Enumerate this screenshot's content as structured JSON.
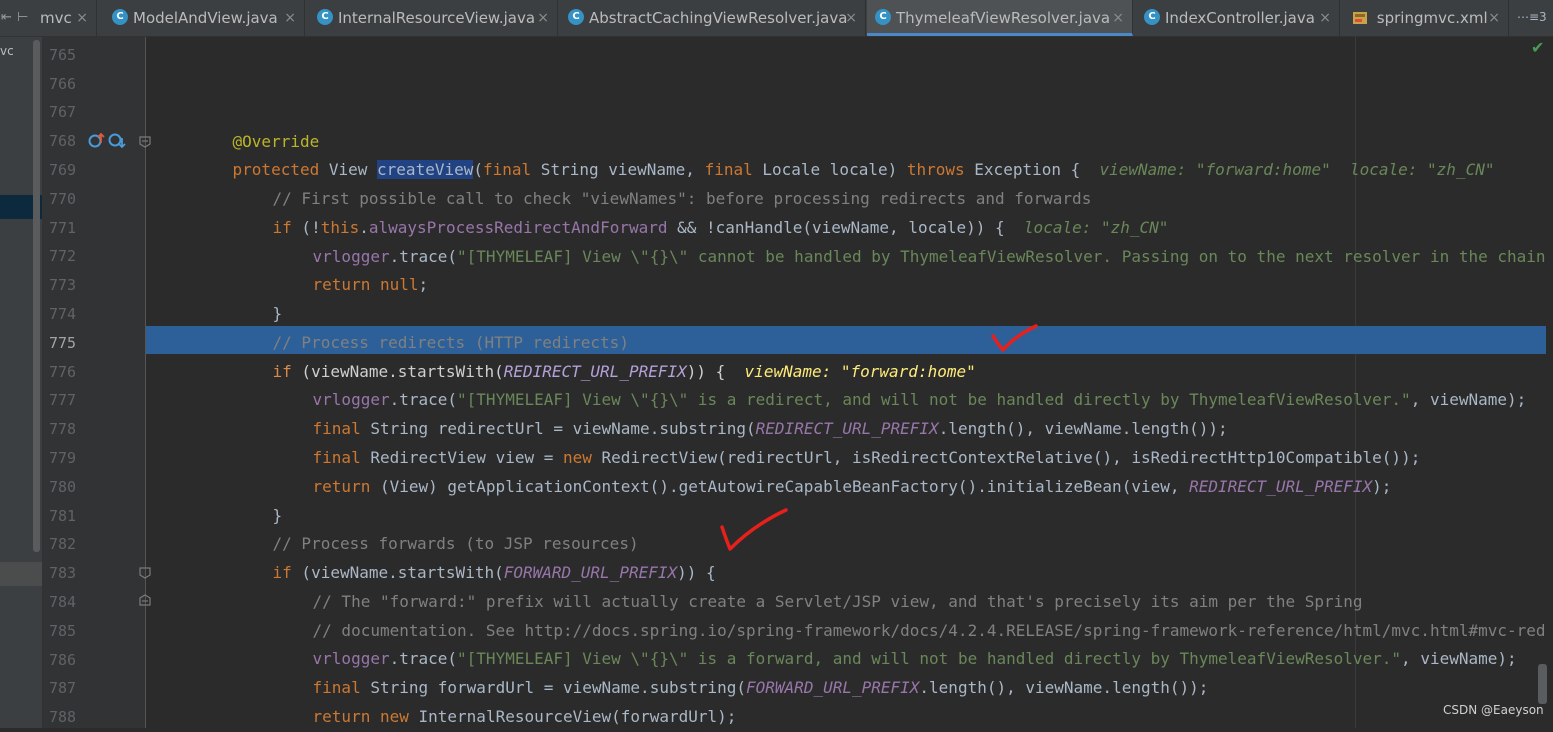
{
  "sidebar": {
    "label": "vc"
  },
  "tabs": [
    {
      "label": "mvc",
      "type": "partial"
    },
    {
      "label": "ModelAndView.java",
      "type": "class"
    },
    {
      "label": "InternalResourceView.java",
      "type": "class"
    },
    {
      "label": "AbstractCachingViewResolver.java",
      "type": "class"
    },
    {
      "label": "ThymeleafViewResolver.java",
      "type": "class",
      "active": true
    },
    {
      "label": "IndexController.java",
      "type": "class"
    },
    {
      "label": "springmvc.xml",
      "type": "xml"
    }
  ],
  "tab_more": "⋯≡3",
  "class_icon_letter": "C",
  "close_glyph": "×",
  "line_numbers": [
    "765",
    "766",
    "767",
    "768",
    "769",
    "770",
    "771",
    "772",
    "773",
    "774",
    "775",
    "776",
    "777",
    "778",
    "779",
    "780",
    "781",
    "782",
    "783",
    "784",
    "785",
    "786",
    "787",
    "788"
  ],
  "code": {
    "l767": "@Override",
    "l768": {
      "kw1": "protected",
      "t1": " View ",
      "fn": "createView",
      "t2": "(",
      "kw2": "final",
      "t3": " String viewName, ",
      "kw3": "final",
      "t4": " Locale locale) ",
      "kw4": "throws",
      "t5": " Exception {  ",
      "hint": "viewName: \"forward:home\"  locale: \"zh_CN\""
    },
    "l769": "// First possible call to check \"viewNames\": before processing redirects and forwards",
    "l770": {
      "kw": "if",
      "t1": " (!",
      "kw2": "this",
      "t2": ".",
      "fld": "alwaysProcessRedirectAndForward",
      "t3": " && !canHandle(viewName, locale)) {  ",
      "hint": "locale: \"zh_CN\""
    },
    "l771": {
      "fld": "vrlogger",
      "t1": ".trace(",
      "str": "\"[THYMELEAF] View \\\"{}\\\" cannot be handled by ThymeleafViewResolver. Passing on to the next resolver in the chain"
    },
    "l772": {
      "kw": "return",
      "t1": " ",
      "kw2": "null",
      "t2": ";"
    },
    "l773": "}",
    "l774": "// Process redirects (HTTP redirects)",
    "l775": {
      "kw": "if",
      "t1": " (viewName.startsWith(",
      "ct": "REDIRECT_URL_PREFIX",
      "t2": ")) {  ",
      "hint": "viewName: \"forward:home\""
    },
    "l776": {
      "fld": "vrlogger",
      "t1": ".trace(",
      "str": "\"[THYMELEAF] View \\\"{}\\\" is a redirect, and will not be handled directly by ThymeleafViewResolver.\"",
      "t2": ", viewName);"
    },
    "l777": {
      "kw": "final",
      "t1": " String redirectUrl = viewName.substring(",
      "ct": "REDIRECT_URL_PREFIX",
      "t2": ".length(), viewName.length());"
    },
    "l778": {
      "kw": "final",
      "t1": " RedirectView view = ",
      "kw2": "new",
      "t2": " RedirectView(redirectUrl, isRedirectContextRelative(), isRedirectHttp10Compatible());"
    },
    "l779": {
      "kw": "return",
      "t1": " (View) getApplicationContext().getAutowireCapableBeanFactory().initializeBean(view, ",
      "ct": "REDIRECT_URL_PREFIX",
      "t2": ");"
    },
    "l780": "}",
    "l781": "// Process forwards (to JSP resources)",
    "l782": {
      "kw": "if",
      "t1": " (viewName.startsWith(",
      "ct": "FORWARD_URL_PREFIX",
      "t2": ")) {"
    },
    "l783": "// The \"forward:\" prefix will actually create a Servlet/JSP view, and that's precisely its aim per the Spring",
    "l784": "// documentation. See http://docs.spring.io/spring-framework/docs/4.2.4.RELEASE/spring-framework-reference/html/mvc.html#mvc-red",
    "l785": {
      "fld": "vrlogger",
      "t1": ".trace(",
      "str": "\"[THYMELEAF] View \\\"{}\\\" is a forward, and will not be handled directly by ThymeleafViewResolver.\"",
      "t2": ", viewName);"
    },
    "l786": {
      "kw": "final",
      "t1": " String forwardUrl = viewName.substring(",
      "ct": "FORWARD_URL_PREFIX",
      "t2": ".length(), viewName.length());"
    },
    "l787": {
      "kw": "return",
      "t1": " ",
      "kw2": "new",
      "t2": " InternalResourceView(forwardUrl);"
    },
    "l788": "}"
  },
  "status_check": "✔",
  "watermark": "CSDN @Eaeyson",
  "colors": {
    "keyword": "#cc7832",
    "annotation": "#bbb529",
    "comment": "#808080",
    "string": "#6a8759",
    "field": "#9876aa",
    "execution_line": "#2d6099",
    "red_mark": "#e8201c"
  },
  "icons": [
    "class-icon",
    "xml-icon",
    "close-icon",
    "override-icon",
    "breakpoint-fold-icon",
    "check-icon",
    "red-checkmark-annotation"
  ]
}
